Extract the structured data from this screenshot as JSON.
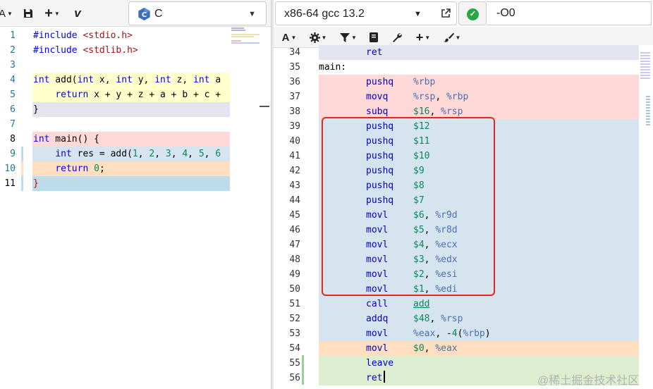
{
  "left_toolbar": {
    "font_menu_label": "A",
    "save_icon": "save-icon",
    "add_menu_label": "+",
    "vim_label": "v",
    "language": "C"
  },
  "source": {
    "lines": [
      {
        "n": "1",
        "html": "<span style=\"color:#0000ff\">#include</span> <span style=\"color:#a31515\">&lt;stdio.h&gt;</span>",
        "bg": ""
      },
      {
        "n": "2",
        "html": "<span style=\"color:#0000ff\">#include</span> <span style=\"color:#a31515\">&lt;stdlib.h&gt;</span>",
        "bg": ""
      },
      {
        "n": "3",
        "html": "",
        "bg": ""
      },
      {
        "n": "4",
        "html": "<span style=\"color:#0000ff\">int</span> add(<span style=\"color:#0000ff\">int</span> x, <span style=\"color:#0000ff\">int</span> y, <span style=\"color:#0000ff\">int</span> z, <span style=\"color:#0000ff\">int</span> a",
        "bg": "#ffffcc"
      },
      {
        "n": "5",
        "html": "    <span style=\"color:#0000ff\">return</span> x + y + z + a + b + c +",
        "bg": "#ffffcc"
      },
      {
        "n": "6",
        "html": "}",
        "bg": "#e4e4f0"
      },
      {
        "n": "7",
        "html": "",
        "bg": ""
      },
      {
        "n": "8",
        "html": "<span style=\"color:#0000ff\">int</span> main() {",
        "bg": "#ffd8d8"
      },
      {
        "n": "9",
        "html": "    <span style=\"color:#0000ff\">int</span> res = add(<span style=\"color:#09885a\">1</span>, <span style=\"color:#09885a\">2</span>, <span style=\"color:#09885a\">3</span>, <span style=\"color:#09885a\">4</span>, <span style=\"color:#09885a\">5</span>, <span style=\"color:#09885a\">6</span>",
        "bg": "#d6e4f0"
      },
      {
        "n": "10",
        "html": "    <span style=\"color:#0000ff\">return</span> <span style=\"color:#09885a\">0</span>;",
        "bg": "#ffdfc0"
      },
      {
        "n": "11",
        "html": "<span style=\"color:#cc0000\">}</span>",
        "bg": "#bcdcec"
      }
    ]
  },
  "compiler": {
    "name": "x86-64 gcc 13.2",
    "options": "-O0",
    "status": "ok"
  },
  "right_toolbar": {
    "output_menu_label": "A",
    "gear_icon": "gear-icon",
    "filter_icon": "filter-icon",
    "book_icon": "book-icon",
    "wrench_icon": "wrench-icon",
    "add_label": "+",
    "brush_icon": "brush-icon"
  },
  "asm": {
    "lines": [
      {
        "n": "34",
        "op": "ret",
        "args": "",
        "label": "",
        "bg": "#e4e4f0"
      },
      {
        "n": "35",
        "op": "",
        "args": "",
        "label": "main:",
        "bg": ""
      },
      {
        "n": "36",
        "op": "pushq",
        "args": "<span class=\"reg\">%rbp</span>",
        "label": "",
        "bg": "#ffd8d8"
      },
      {
        "n": "37",
        "op": "movq",
        "args": "<span class=\"reg\">%rsp</span>, <span class=\"reg\">%rbp</span>",
        "label": "",
        "bg": "#ffd8d8"
      },
      {
        "n": "38",
        "op": "subq",
        "args": "<span class=\"num\">$16</span>, <span class=\"reg\">%rsp</span>",
        "label": "",
        "bg": "#ffd8d8"
      },
      {
        "n": "39",
        "op": "pushq",
        "args": "<span class=\"num\">$12</span>",
        "label": "",
        "bg": "#d6e4f0"
      },
      {
        "n": "40",
        "op": "pushq",
        "args": "<span class=\"num\">$11</span>",
        "label": "",
        "bg": "#d6e4f0"
      },
      {
        "n": "41",
        "op": "pushq",
        "args": "<span class=\"num\">$10</span>",
        "label": "",
        "bg": "#d6e4f0"
      },
      {
        "n": "42",
        "op": "pushq",
        "args": "<span class=\"num\">$9</span>",
        "label": "",
        "bg": "#d6e4f0"
      },
      {
        "n": "43",
        "op": "pushq",
        "args": "<span class=\"num\">$8</span>",
        "label": "",
        "bg": "#d6e4f0"
      },
      {
        "n": "44",
        "op": "pushq",
        "args": "<span class=\"num\">$7</span>",
        "label": "",
        "bg": "#d6e4f0"
      },
      {
        "n": "45",
        "op": "movl",
        "args": "<span class=\"num\">$6</span>, <span class=\"reg\">%r9d</span>",
        "label": "",
        "bg": "#d6e4f0"
      },
      {
        "n": "46",
        "op": "movl",
        "args": "<span class=\"num\">$5</span>, <span class=\"reg\">%r8d</span>",
        "label": "",
        "bg": "#d6e4f0"
      },
      {
        "n": "47",
        "op": "movl",
        "args": "<span class=\"num\">$4</span>, <span class=\"reg\">%ecx</span>",
        "label": "",
        "bg": "#d6e4f0"
      },
      {
        "n": "48",
        "op": "movl",
        "args": "<span class=\"num\">$3</span>, <span class=\"reg\">%edx</span>",
        "label": "",
        "bg": "#d6e4f0"
      },
      {
        "n": "49",
        "op": "movl",
        "args": "<span class=\"num\">$2</span>, <span class=\"reg\">%esi</span>",
        "label": "",
        "bg": "#d6e4f0"
      },
      {
        "n": "50",
        "op": "movl",
        "args": "<span class=\"num\">$1</span>, <span class=\"reg\">%edi</span>",
        "label": "",
        "bg": "#d6e4f0"
      },
      {
        "n": "51",
        "op": "call",
        "args": "<span class=\"fnlink\">add</span>",
        "label": "",
        "bg": "#d6e4f0"
      },
      {
        "n": "52",
        "op": "addq",
        "args": "<span class=\"num\">$48</span>, <span class=\"reg\">%rsp</span>",
        "label": "",
        "bg": "#d6e4f0"
      },
      {
        "n": "53",
        "op": "movl",
        "args": "<span class=\"reg\">%eax</span>, -<span class=\"num\">4</span>(<span class=\"reg\">%rbp</span>)",
        "label": "",
        "bg": "#d6e4f0"
      },
      {
        "n": "54",
        "op": "movl",
        "args": "<span class=\"num\">$0</span>, <span class=\"reg\">%eax</span>",
        "label": "",
        "bg": "#ffdfc0"
      },
      {
        "n": "55",
        "op": "leave",
        "args": "",
        "label": "",
        "bg": "#ddeed0"
      },
      {
        "n": "56",
        "op": "ret",
        "args": "",
        "label": "",
        "bg": "#ddeed0"
      }
    ]
  },
  "watermark": "@稀土掘金技术社区"
}
